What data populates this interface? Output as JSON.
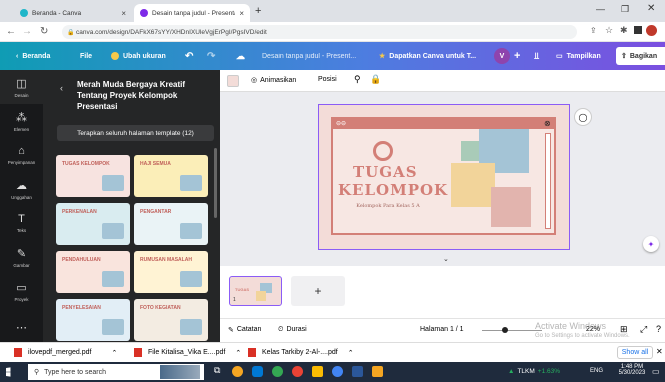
{
  "browser": {
    "tabs": [
      {
        "label": "Beranda - Canva",
        "color": "#1fb6c9"
      },
      {
        "label": "Desain tanpa judul - Presentasi",
        "color": "#7d2ae8"
      }
    ],
    "new_tab": "+",
    "url": "canva.com/design/DAFkX67sYY/XHDnIXUleVgjErPgI/PgsIVD/edit"
  },
  "canva_bar": {
    "home": "Beranda",
    "file": "File",
    "resize": "Ubah ukuran",
    "title": "Desain tanpa judul - Present...",
    "upgrade": "Dapatkan Canva untuk T...",
    "avatar": "V",
    "present": "Tampilkan",
    "share": "Bagikan"
  },
  "rail": [
    "Desain",
    "Elemen",
    "Penyimpanan",
    "Unggahan",
    "Teks",
    "Gambar",
    "Proyek"
  ],
  "panel": {
    "title": "Merah Muda Bergaya Kreatif Tentang Proyek Kelompok Presentasi",
    "apply": "Terapkan seluruh halaman template (12)",
    "thumbs": [
      {
        "label": "TUGAS KELOMPOK",
        "bg": "#f7e3e0"
      },
      {
        "label": "HAJI SEMUA",
        "bg": "#fbeeb8"
      },
      {
        "label": "PERKENALAN",
        "bg": "#d9ecf0"
      },
      {
        "label": "PENGANTAR",
        "bg": "#eaf3f6"
      },
      {
        "label": "PENDAHULUAN",
        "bg": "#f9e4dd"
      },
      {
        "label": "RUMUSAN MASALAH",
        "bg": "#fff3d4"
      },
      {
        "label": "PENYELESAIAN",
        "bg": "#e2eef6"
      },
      {
        "label": "FOTO KEGIATAN",
        "bg": "#f3ece2"
      }
    ]
  },
  "toolbar": {
    "animate": "Animasikan",
    "position": "Posisi"
  },
  "slide": {
    "title1": "TUGAS",
    "title2": "KELOMPOK",
    "subtitle": "Kelompok Para Kelas 5 A",
    "bg": "#f3dcd8",
    "accent": "#d37f77"
  },
  "pages": {
    "page_num": "1",
    "add": "+"
  },
  "status": {
    "notes": "Catatan",
    "duration": "Durasi",
    "page": "Halaman 1 / 1",
    "zoom": "22%",
    "watermark1": "Activate Windows",
    "watermark2": "Go to Settings to activate Windows."
  },
  "downloads": [
    {
      "name": "ilovepdf_merged.pdf"
    },
    {
      "name": "File Kitalisa_Vika E....pdf"
    },
    {
      "name": "Kelas Tarkiby 2-Al-....pdf"
    }
  ],
  "show_all": "Show all",
  "taskbar": {
    "search": "Type here to search",
    "tray": "TLKM",
    "tray_val": "+1.63%",
    "lang": "ENG",
    "time": "1:48 PM",
    "date": "5/30/2023"
  }
}
